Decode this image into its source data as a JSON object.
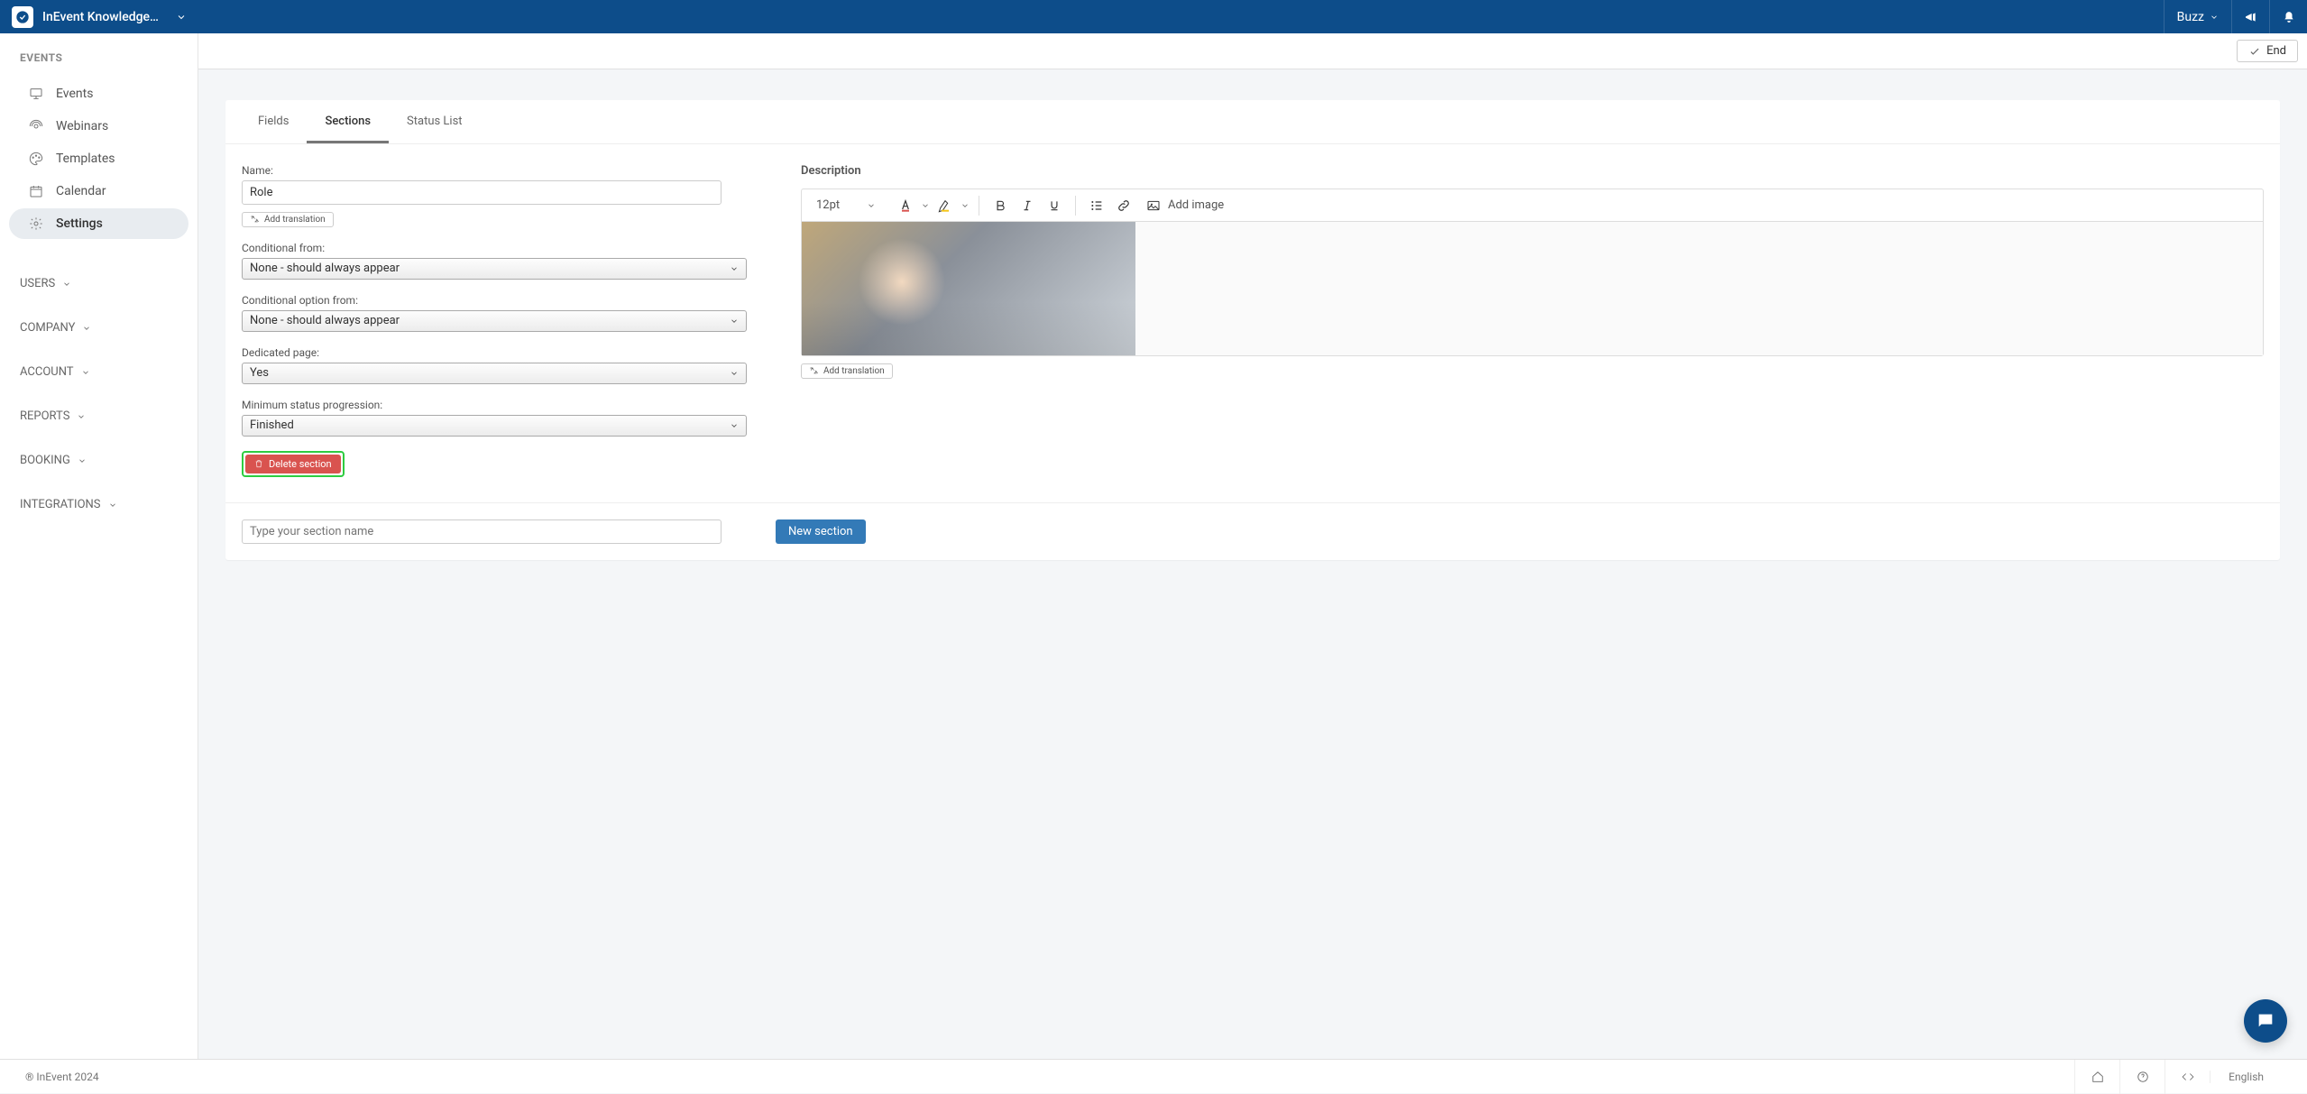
{
  "header": {
    "brand": "InEvent Knowledge ...",
    "user": "Buzz",
    "end_label": "End"
  },
  "sidebar": {
    "section_title": "EVENTS",
    "items": [
      {
        "label": "Events"
      },
      {
        "label": "Webinars"
      },
      {
        "label": "Templates"
      },
      {
        "label": "Calendar"
      },
      {
        "label": "Settings"
      }
    ],
    "groups": [
      "USERS",
      "COMPANY",
      "ACCOUNT",
      "REPORTS",
      "BOOKING",
      "INTEGRATIONS"
    ]
  },
  "tabs": [
    "Fields",
    "Sections",
    "Status List"
  ],
  "form": {
    "name_label": "Name:",
    "name_value": "Role",
    "add_translation": "Add translation",
    "cond_from_label": "Conditional from:",
    "cond_from_value": "None - should always appear",
    "cond_opt_label": "Conditional option from:",
    "cond_opt_value": "None - should always appear",
    "dedicated_label": "Dedicated page:",
    "dedicated_value": "Yes",
    "min_status_label": "Minimum status progression:",
    "min_status_value": "Finished",
    "delete_label": "Delete section"
  },
  "editor": {
    "description_label": "Description",
    "font_size": "12pt",
    "add_image": "Add image",
    "add_translation": "Add translation"
  },
  "new_section": {
    "placeholder": "Type your section name",
    "button": "New section"
  },
  "footer": {
    "copyright": "® InEvent 2024",
    "language": "English"
  }
}
